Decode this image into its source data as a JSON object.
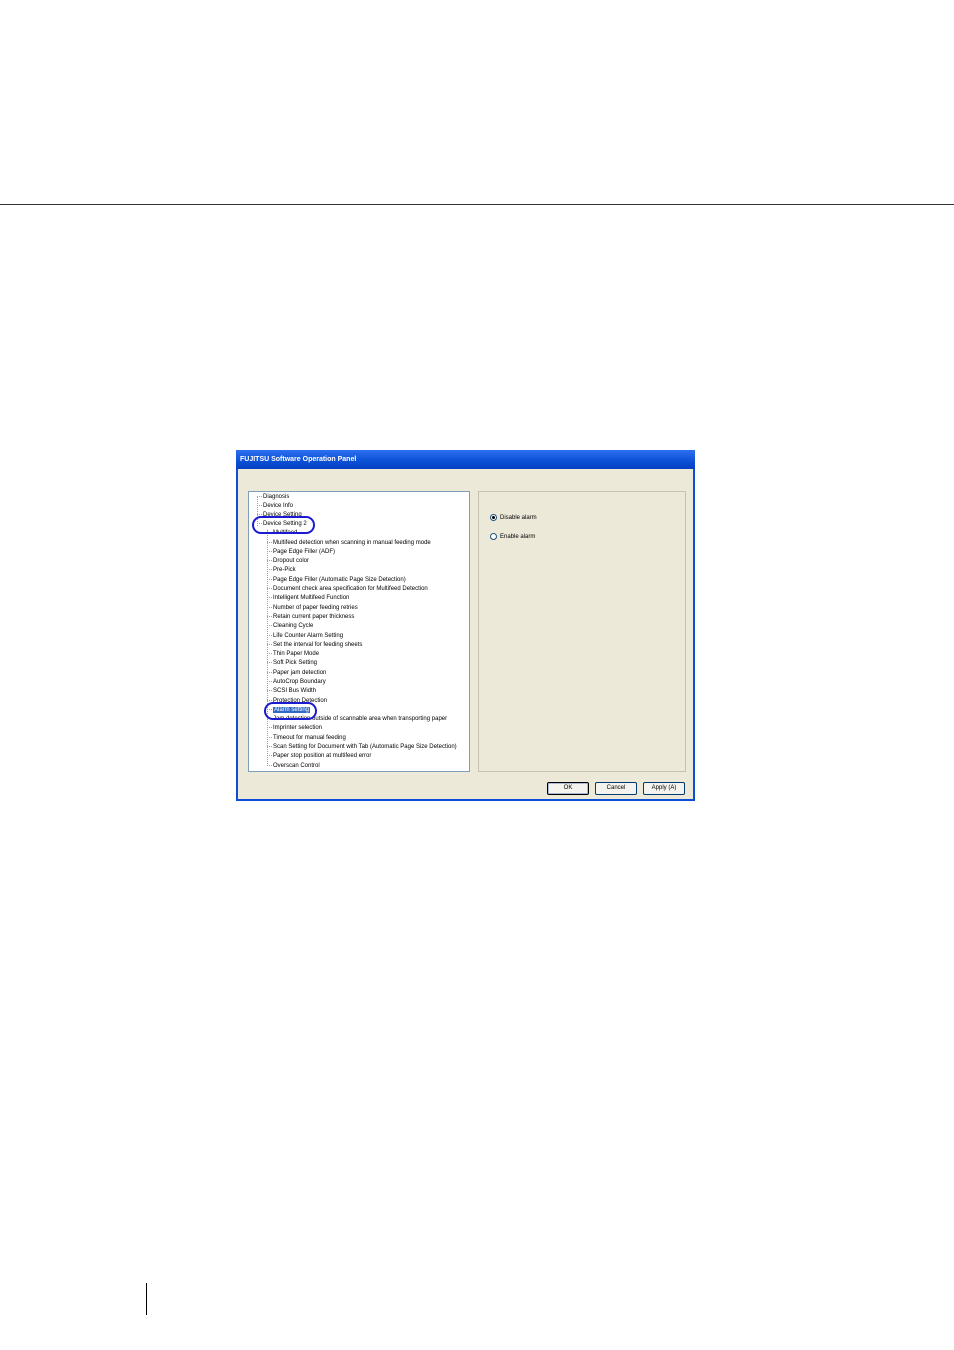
{
  "window": {
    "title": "FUJITSU Software Operation Panel"
  },
  "tree": {
    "roots": [
      {
        "label": "Diagnosis"
      },
      {
        "label": "Device Info"
      },
      {
        "label": "Device Setting"
      },
      {
        "label": "Device Setting 2"
      }
    ],
    "children": [
      {
        "label": "Multifeed"
      },
      {
        "label": "Multifeed detection when scanning in manual feeding mode"
      },
      {
        "label": "Page Edge Filler (ADF)"
      },
      {
        "label": "Dropout color"
      },
      {
        "label": "Pre-Pick"
      },
      {
        "label": "Page Edge Filler (Automatic Page Size Detection)"
      },
      {
        "label": "Document check area specification for Multifeed Detection"
      },
      {
        "label": "Intelligent Multifeed Function"
      },
      {
        "label": "Number of paper feeding retries"
      },
      {
        "label": "Retain current paper thickness"
      },
      {
        "label": "Cleaning Cycle"
      },
      {
        "label": "Life Counter Alarm Setting"
      },
      {
        "label": "Set the interval for feeding sheets"
      },
      {
        "label": "Thin Paper Mode"
      },
      {
        "label": "Soft Pick Setting"
      },
      {
        "label": "Paper jam detection"
      },
      {
        "label": "AutoCrop Boundary"
      },
      {
        "label": "SCSI Bus Width"
      },
      {
        "label": "Protection Detection"
      },
      {
        "label": "Alarm setting"
      },
      {
        "label": "Jam detection outside of scannable area when transporting paper"
      },
      {
        "label": "Imprinter selection"
      },
      {
        "label": "Timeout for manual feeding"
      },
      {
        "label": "Scan Setting for Document with Tab (Automatic Page Size Detection)"
      },
      {
        "label": "Paper stop position at multifeed error"
      },
      {
        "label": "Overscan Control"
      }
    ],
    "selected": "Alarm setting"
  },
  "options": {
    "disable_alarm": "Disable alarm",
    "enable_alarm": "Enable alarm",
    "selected": "Disable alarm"
  },
  "buttons": {
    "ok": "OK",
    "cancel": "Cancel",
    "apply": "Apply (A)"
  },
  "colors": {
    "title_bar": "#0a4fd6",
    "highlight_oval": "#1a1ad0",
    "selection": "#316ac5",
    "dialog_background": "#ece9d8"
  }
}
